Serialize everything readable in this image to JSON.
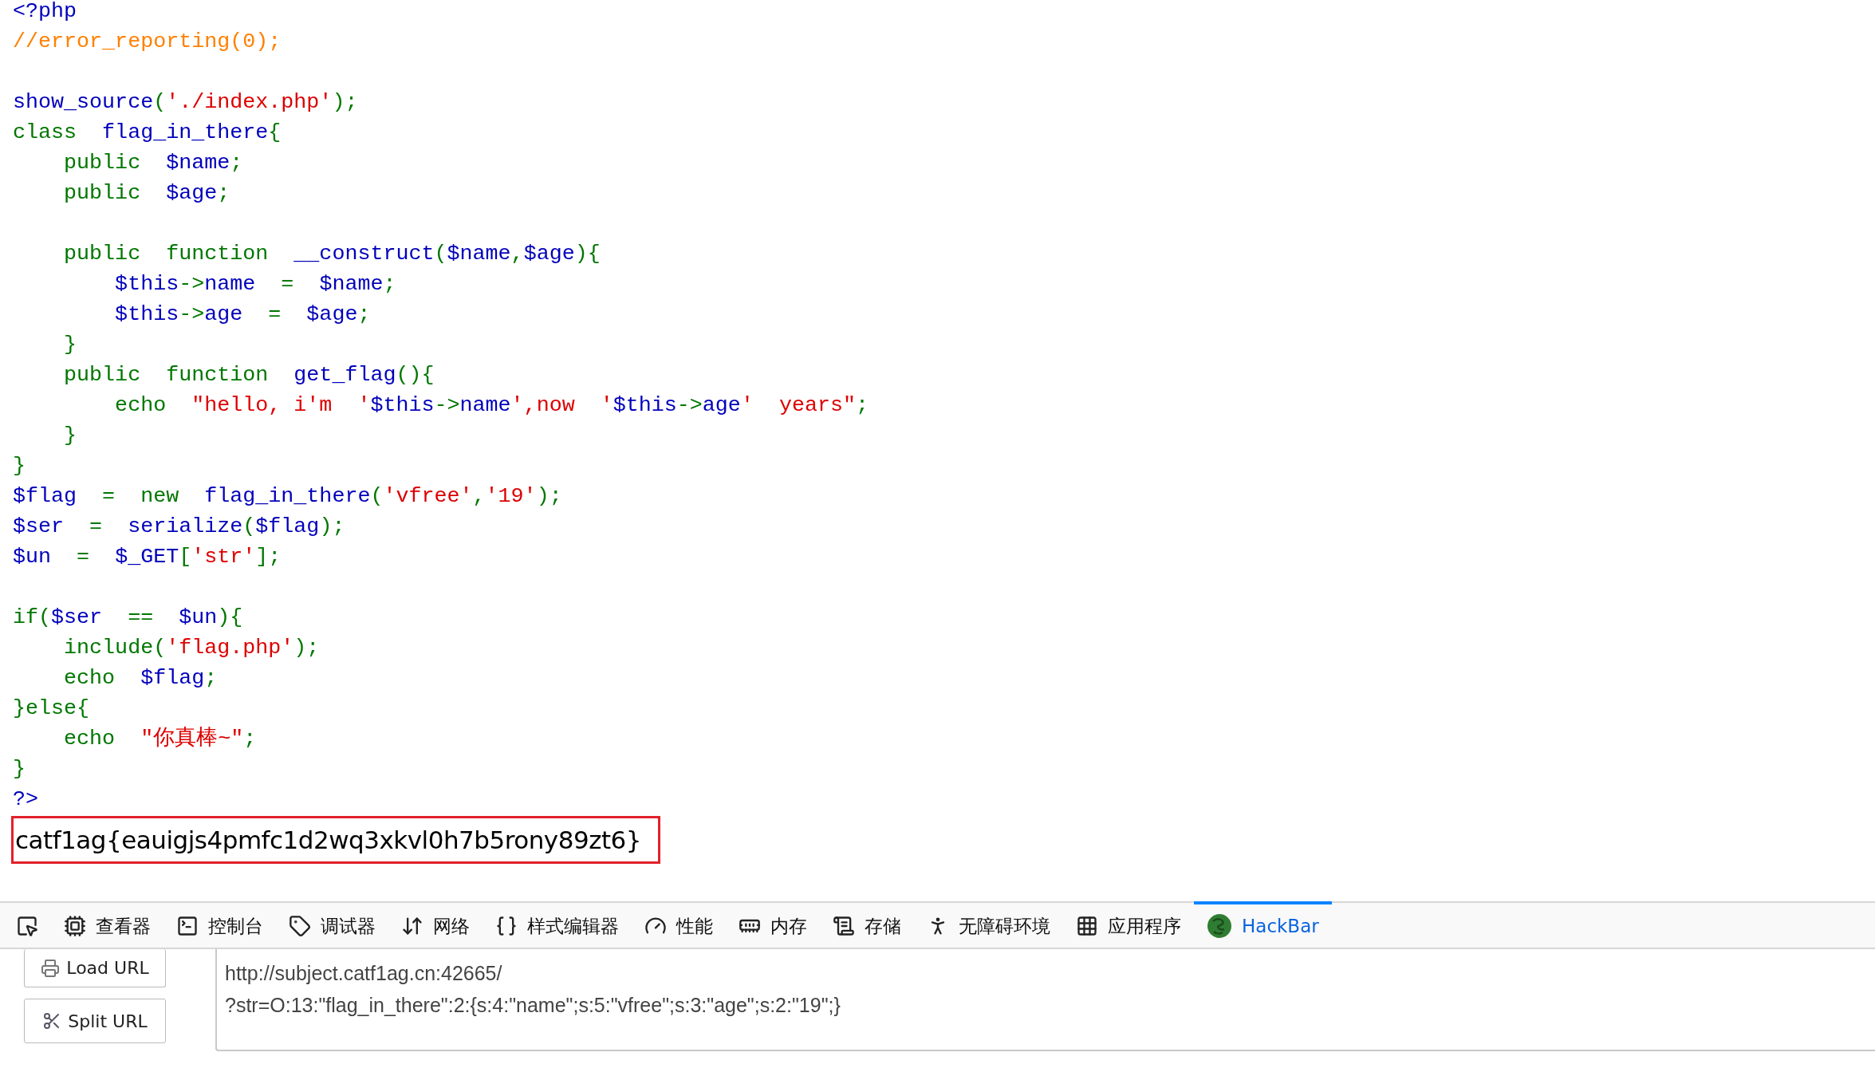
{
  "code_lines": [
    {
      "kind": "code",
      "tokens": [
        {
          "kind": "default",
          "text": "<?php"
        }
      ]
    },
    {
      "kind": "code",
      "tokens": [
        {
          "kind": "comment",
          "text": "//error_reporting(0);"
        }
      ]
    },
    {
      "kind": "blank"
    },
    {
      "kind": "code",
      "tokens": [
        {
          "kind": "default",
          "text": "show_source"
        },
        {
          "kind": "keyword",
          "text": "("
        },
        {
          "kind": "string",
          "text": "'./index.php'"
        },
        {
          "kind": "keyword",
          "text": ");"
        }
      ]
    },
    {
      "kind": "code",
      "tokens": [
        {
          "kind": "keyword",
          "text": "class"
        },
        {
          "kind": "default",
          "text": "  flag_in_there"
        },
        {
          "kind": "keyword",
          "text": "{"
        }
      ]
    },
    {
      "kind": "code",
      "tokens": [
        {
          "kind": "keyword",
          "text": "    public  "
        },
        {
          "kind": "default",
          "text": "$name"
        },
        {
          "kind": "keyword",
          "text": ";"
        }
      ]
    },
    {
      "kind": "code",
      "tokens": [
        {
          "kind": "keyword",
          "text": "    public  "
        },
        {
          "kind": "default",
          "text": "$age"
        },
        {
          "kind": "keyword",
          "text": ";"
        }
      ]
    },
    {
      "kind": "blank"
    },
    {
      "kind": "code",
      "tokens": [
        {
          "kind": "keyword",
          "text": "    public  function  "
        },
        {
          "kind": "default",
          "text": "__construct"
        },
        {
          "kind": "keyword",
          "text": "("
        },
        {
          "kind": "default",
          "text": "$name"
        },
        {
          "kind": "keyword",
          "text": ","
        },
        {
          "kind": "default",
          "text": "$age"
        },
        {
          "kind": "keyword",
          "text": "){"
        }
      ]
    },
    {
      "kind": "code",
      "tokens": [
        {
          "kind": "default",
          "text": "        $this"
        },
        {
          "kind": "keyword",
          "text": "->"
        },
        {
          "kind": "default",
          "text": "name  "
        },
        {
          "kind": "keyword",
          "text": "=  "
        },
        {
          "kind": "default",
          "text": "$name"
        },
        {
          "kind": "keyword",
          "text": ";"
        }
      ]
    },
    {
      "kind": "code",
      "tokens": [
        {
          "kind": "default",
          "text": "        $this"
        },
        {
          "kind": "keyword",
          "text": "->"
        },
        {
          "kind": "default",
          "text": "age  "
        },
        {
          "kind": "keyword",
          "text": "=  "
        },
        {
          "kind": "default",
          "text": "$age"
        },
        {
          "kind": "keyword",
          "text": ";"
        }
      ]
    },
    {
      "kind": "code",
      "tokens": [
        {
          "kind": "keyword",
          "text": "    }"
        }
      ]
    },
    {
      "kind": "code",
      "tokens": [
        {
          "kind": "keyword",
          "text": "    public  function  "
        },
        {
          "kind": "default",
          "text": "get_flag"
        },
        {
          "kind": "keyword",
          "text": "(){"
        }
      ]
    },
    {
      "kind": "code",
      "tokens": [
        {
          "kind": "keyword",
          "text": "        echo  "
        },
        {
          "kind": "string",
          "text": "\"hello, i'm  '"
        },
        {
          "kind": "default",
          "text": "$this"
        },
        {
          "kind": "keyword",
          "text": "->"
        },
        {
          "kind": "default",
          "text": "name"
        },
        {
          "kind": "string",
          "text": "',now  '"
        },
        {
          "kind": "default",
          "text": "$this"
        },
        {
          "kind": "keyword",
          "text": "->"
        },
        {
          "kind": "default",
          "text": "age"
        },
        {
          "kind": "string",
          "text": "'  years\""
        },
        {
          "kind": "keyword",
          "text": ";"
        }
      ]
    },
    {
      "kind": "code",
      "tokens": [
        {
          "kind": "keyword",
          "text": "    }"
        }
      ]
    },
    {
      "kind": "code",
      "tokens": [
        {
          "kind": "keyword",
          "text": "}"
        }
      ]
    },
    {
      "kind": "code",
      "tokens": [
        {
          "kind": "default",
          "text": "$flag"
        },
        {
          "kind": "keyword",
          "text": "  =  new  "
        },
        {
          "kind": "default",
          "text": "flag_in_there"
        },
        {
          "kind": "keyword",
          "text": "("
        },
        {
          "kind": "string",
          "text": "'vfree'"
        },
        {
          "kind": "keyword",
          "text": ","
        },
        {
          "kind": "string",
          "text": "'19'"
        },
        {
          "kind": "keyword",
          "text": ");"
        }
      ]
    },
    {
      "kind": "code",
      "tokens": [
        {
          "kind": "default",
          "text": "$ser"
        },
        {
          "kind": "keyword",
          "text": "  =  "
        },
        {
          "kind": "default",
          "text": "serialize"
        },
        {
          "kind": "keyword",
          "text": "("
        },
        {
          "kind": "default",
          "text": "$flag"
        },
        {
          "kind": "keyword",
          "text": ");"
        }
      ]
    },
    {
      "kind": "code",
      "tokens": [
        {
          "kind": "default",
          "text": "$un"
        },
        {
          "kind": "keyword",
          "text": "  =  "
        },
        {
          "kind": "default",
          "text": "$_GET"
        },
        {
          "kind": "keyword",
          "text": "["
        },
        {
          "kind": "string",
          "text": "'str'"
        },
        {
          "kind": "keyword",
          "text": "];"
        }
      ]
    },
    {
      "kind": "blank"
    },
    {
      "kind": "code",
      "tokens": [
        {
          "kind": "keyword",
          "text": "if("
        },
        {
          "kind": "default",
          "text": "$ser"
        },
        {
          "kind": "keyword",
          "text": "  ==  "
        },
        {
          "kind": "default",
          "text": "$un"
        },
        {
          "kind": "keyword",
          "text": "){"
        }
      ]
    },
    {
      "kind": "code",
      "tokens": [
        {
          "kind": "keyword",
          "text": "    include("
        },
        {
          "kind": "string",
          "text": "'flag.php'"
        },
        {
          "kind": "keyword",
          "text": ");"
        }
      ]
    },
    {
      "kind": "code",
      "tokens": [
        {
          "kind": "keyword",
          "text": "    echo  "
        },
        {
          "kind": "default",
          "text": "$flag"
        },
        {
          "kind": "keyword",
          "text": ";"
        }
      ]
    },
    {
      "kind": "code",
      "tokens": [
        {
          "kind": "keyword",
          "text": "}else{"
        }
      ]
    },
    {
      "kind": "code",
      "tokens": [
        {
          "kind": "keyword",
          "text": "    echo  "
        },
        {
          "kind": "string",
          "text": "\"你真棒~\""
        },
        {
          "kind": "keyword",
          "text": ";"
        }
      ]
    },
    {
      "kind": "code",
      "tokens": [
        {
          "kind": "keyword",
          "text": "}"
        }
      ]
    },
    {
      "kind": "code",
      "tokens": [
        {
          "kind": "default",
          "text": "?>"
        }
      ]
    }
  ],
  "output": {
    "text": "catf1ag{eauigjs4pmfc1d2wq3xkvl0h7b5rony89zt6}",
    "highlighted": true
  },
  "devtools_tabs": [
    {
      "kind": "picker",
      "selected": false
    },
    {
      "kind": "inspector",
      "label": "查看器",
      "selected": false
    },
    {
      "kind": "console",
      "label": "控制台",
      "selected": false
    },
    {
      "kind": "debugger",
      "label": "调试器",
      "selected": false
    },
    {
      "kind": "network",
      "label": "网络",
      "selected": false
    },
    {
      "kind": "style",
      "label": "样式编辑器",
      "selected": false
    },
    {
      "kind": "performance",
      "label": "性能",
      "selected": false
    },
    {
      "kind": "memory",
      "label": "内存",
      "selected": false
    },
    {
      "kind": "storage",
      "label": "存储",
      "selected": false
    },
    {
      "kind": "accessibility",
      "label": "无障碍环境",
      "selected": false
    },
    {
      "kind": "apps",
      "label": "应用程序",
      "selected": false
    },
    {
      "kind": "hackbar",
      "label": "HackBar",
      "selected": true
    }
  ],
  "hackbar": {
    "buttons": [
      {
        "kind": "load",
        "label": "Load URL"
      },
      {
        "kind": "split",
        "label": "Split URL"
      }
    ],
    "url_lines": [
      "http://subject.catf1ag.cn:42665/",
      "?str=O:13:\"flag_in_there\":2:{s:4:\"name\";s:5:\"vfree\";s:3:\"age\";s:2:\"19\";}"
    ]
  }
}
